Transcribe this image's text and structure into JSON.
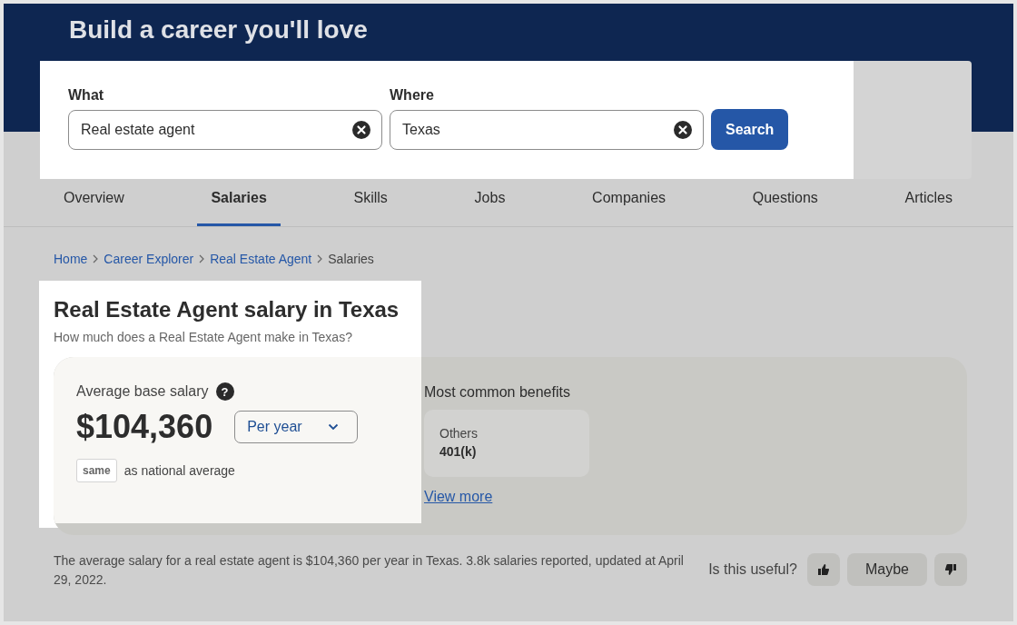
{
  "header": {
    "title": "Build a career you'll love"
  },
  "search": {
    "fields": [
      {
        "label": "What",
        "value": "Real estate agent"
      },
      {
        "label": "Where",
        "value": "Texas"
      }
    ],
    "button": "Search"
  },
  "tabs": [
    {
      "label": "Overview",
      "selected": false
    },
    {
      "label": "Salaries",
      "selected": true
    },
    {
      "label": "Skills",
      "selected": false
    },
    {
      "label": "Jobs",
      "selected": false
    },
    {
      "label": "Companies",
      "selected": false
    },
    {
      "label": "Questions",
      "selected": false
    },
    {
      "label": "Articles",
      "selected": false
    }
  ],
  "breadcrumb": [
    {
      "label": "Home",
      "kind": "link"
    },
    {
      "label": "Career Explorer",
      "kind": "link"
    },
    {
      "label": "Real Estate Agent",
      "kind": "link"
    },
    {
      "label": "Salaries",
      "kind": "current"
    }
  ],
  "salary": {
    "title": "Real Estate Agent salary in Texas",
    "subtitle": "How much does a Real Estate Agent make in Texas?",
    "label": "Average base salary",
    "help": "?",
    "amount": "$104,360",
    "period": "Per year",
    "comparison_badge": "same",
    "comparison_text": "as national average"
  },
  "benefits": {
    "title": "Most common benefits",
    "items": [
      {
        "category": "Others",
        "name": "401(k)"
      }
    ],
    "link": "View more"
  },
  "summary": "The average salary for a real estate agent is $104,360 per year in Texas.  3.8k salaries reported, updated at April 29, 2022.",
  "feedback": {
    "question": "Is this useful?",
    "buttons": [
      {
        "kind": "thumbs_up"
      },
      {
        "kind": "text",
        "label": "Maybe"
      },
      {
        "kind": "thumbs_down"
      }
    ]
  }
}
